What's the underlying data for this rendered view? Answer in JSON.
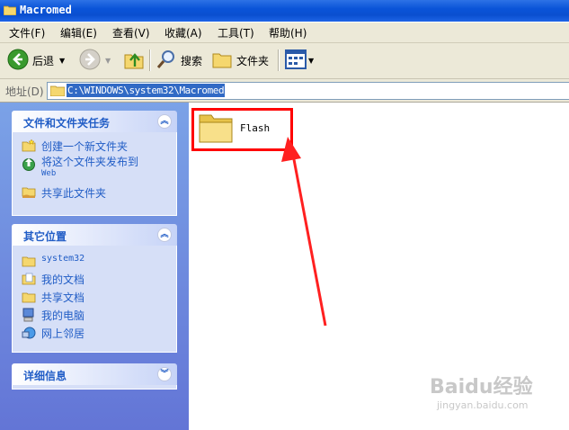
{
  "window": {
    "title": "Macromed",
    "title_icon": "folder-icon"
  },
  "menu": [
    "文件(F)",
    "编辑(E)",
    "查看(V)",
    "收藏(A)",
    "工具(T)",
    "帮助(H)"
  ],
  "toolbar": {
    "back_label": "后退",
    "search_label": "搜索",
    "folders_label": "文件夹"
  },
  "address": {
    "label": "地址(D)",
    "value": "C:\\WINDOWS\\system32\\Macromed"
  },
  "tasks_panel": {
    "title": "文件和文件夹任务",
    "items": [
      {
        "label": "创建一个新文件夹",
        "icon": "new-folder-icon"
      },
      {
        "label": "将这个文件夹发布到",
        "label2": "Web",
        "icon": "publish-web-icon"
      },
      {
        "label": "共享此文件夹",
        "icon": "share-folder-icon"
      }
    ]
  },
  "places_panel": {
    "title": "其它位置",
    "items": [
      {
        "label": "system32",
        "icon": "folder-icon"
      },
      {
        "label": "我的文档",
        "icon": "my-documents-icon"
      },
      {
        "label": "共享文档",
        "icon": "shared-documents-icon"
      },
      {
        "label": "我的电脑",
        "icon": "my-computer-icon"
      },
      {
        "label": "网上邻居",
        "icon": "network-places-icon"
      }
    ]
  },
  "details_panel": {
    "title": "详细信息"
  },
  "content": {
    "items": [
      {
        "name": "Flash",
        "type": "folder"
      }
    ]
  },
  "colors": {
    "title_bar": "#0a54d8",
    "link": "#215dc6",
    "highlight": "#ff0000",
    "selection": "#316ac5"
  },
  "watermark": {
    "line1": "Baidu经验",
    "line2": "jingyan.baidu.com"
  }
}
